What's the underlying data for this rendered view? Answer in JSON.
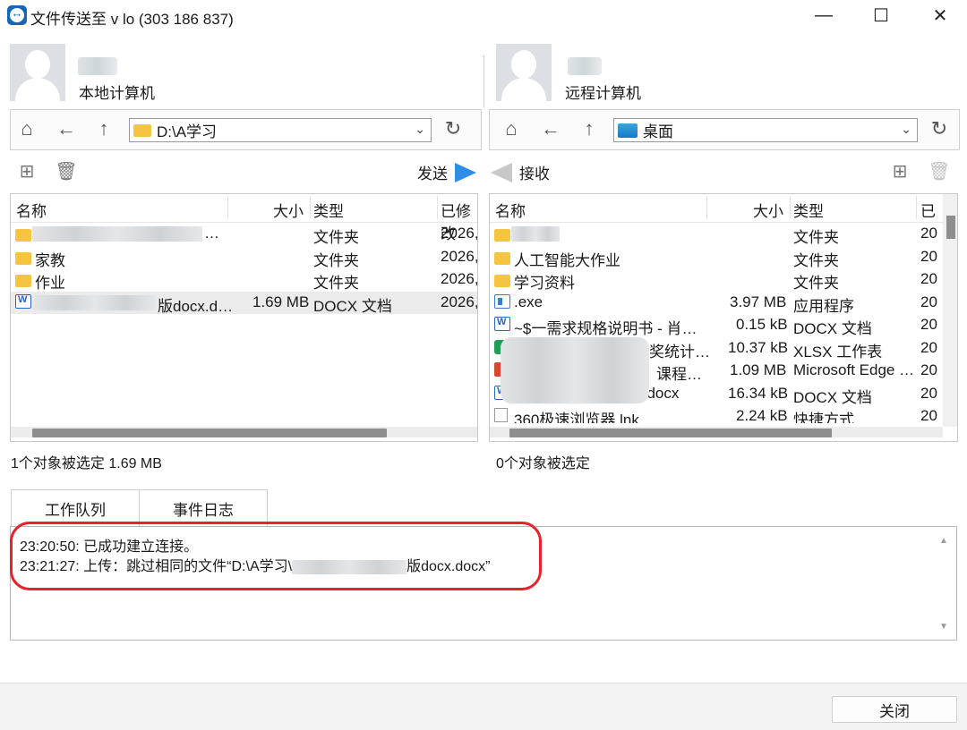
{
  "window": {
    "title": "文件传送至 v lo (303 186 837)",
    "minimize_glyph": "—",
    "maximize_glyph": "☐",
    "close_glyph": "✕",
    "icon": "teamviewer-icon"
  },
  "local": {
    "label": "本地计算机",
    "path": "D:\\A学习",
    "send_label": "发送",
    "columns": [
      "名称",
      "大小",
      "类型",
      "已修改"
    ],
    "rows": [
      {
        "icon": "folder-icon",
        "name": "…",
        "size": "",
        "type": "文件夹",
        "date": "2026,"
      },
      {
        "icon": "folder-icon",
        "name": "家教",
        "size": "",
        "type": "文件夹",
        "date": "2026,"
      },
      {
        "icon": "folder-icon",
        "name": "作业",
        "size": "",
        "type": "文件夹",
        "date": "2026,"
      },
      {
        "icon": "word-icon",
        "name": "版docx.d…",
        "size": "1.69 MB",
        "type": "DOCX 文档",
        "date": "2026,"
      }
    ],
    "status": "1个对象被选定  1.69 MB"
  },
  "remote": {
    "label": "远程计算机",
    "path": "桌面",
    "receive_label": "接收",
    "columns": [
      "名称",
      "大小",
      "类型",
      "已"
    ],
    "rows": [
      {
        "icon": "folder-icon",
        "name": "",
        "size": "",
        "type": "文件夹",
        "date": "20"
      },
      {
        "icon": "folder-icon",
        "name": "人工智能大作业",
        "size": "",
        "type": "文件夹",
        "date": "20"
      },
      {
        "icon": "folder-icon",
        "name": "学习资料",
        "size": "",
        "type": "文件夹",
        "date": "20"
      },
      {
        "icon": "exe-icon",
        "name": ".exe",
        "size": "3.97 MB",
        "type": "应用程序",
        "date": "20"
      },
      {
        "icon": "word-icon",
        "name": "~$一需求规格说明书 - 肖…",
        "size": "0.15 kB",
        "type": "DOCX 文档",
        "date": "20"
      },
      {
        "icon": "xlsx-icon",
        "name": "奖统计…",
        "size": "10.37 kB",
        "type": "XLSX 工作表",
        "date": "20"
      },
      {
        "icon": "pdf-icon",
        "name": "课程…",
        "size": "1.09 MB",
        "type": "Microsoft Edge …",
        "date": "20"
      },
      {
        "icon": "word-icon",
        "name": "\\.docx",
        "size": "16.34 kB",
        "type": "DOCX 文档",
        "date": "20"
      },
      {
        "icon": "shortcut-icon",
        "name": "360极速浏览器.lnk",
        "size": "2.24 kB",
        "type": "快捷方式",
        "date": "20"
      }
    ],
    "status": "0个对象被选定"
  },
  "tabs": [
    "工作队列",
    "事件日志"
  ],
  "log": [
    "23:20:50: 已成功建立连接。",
    "23:21:27: 上传：跳过相同的文件“D:\\A学习\\",
    "版docx.docx”"
  ],
  "close_label": "关闭",
  "colors": {
    "accent": "#2f8de8",
    "highlight": "#e8212a",
    "folder": "#f5c542"
  }
}
